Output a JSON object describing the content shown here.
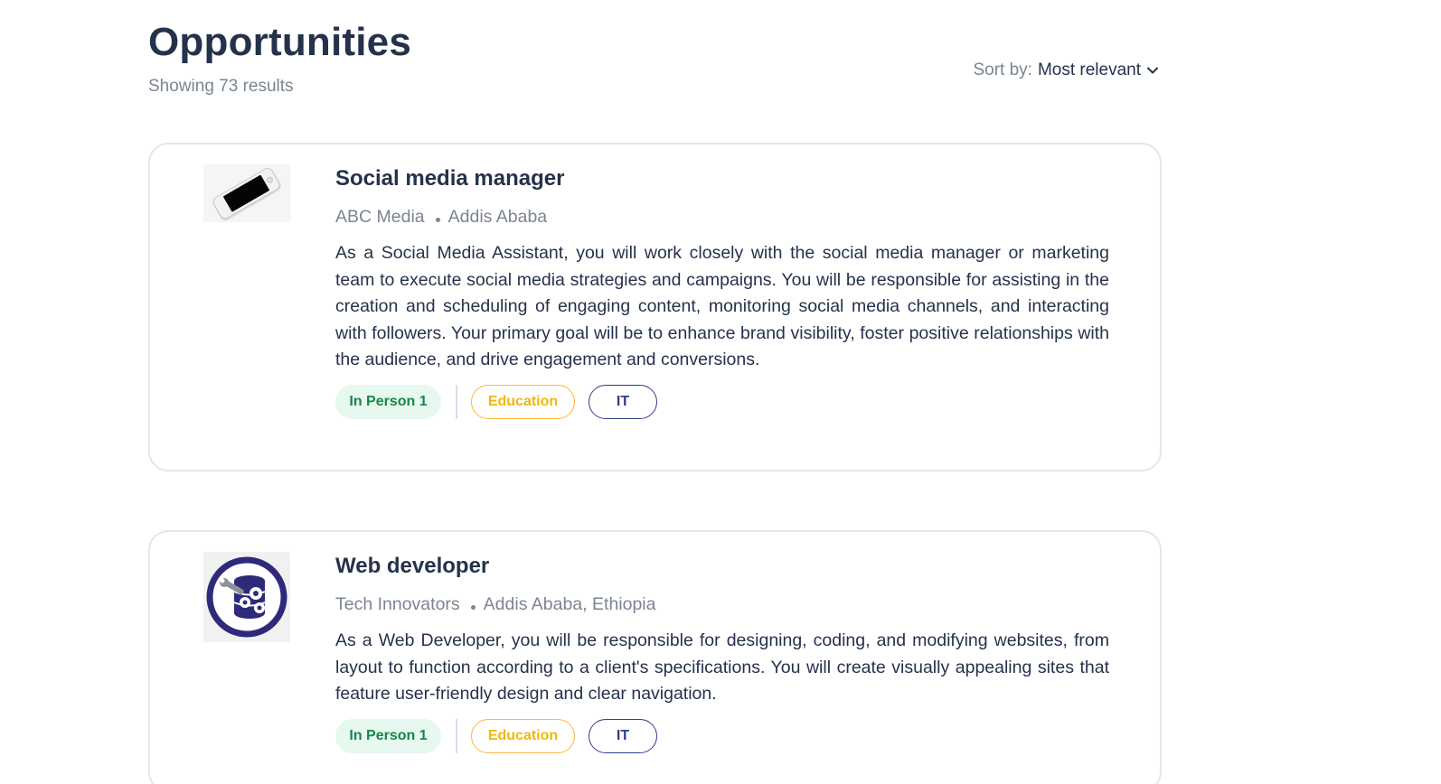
{
  "header": {
    "title": "Opportunities",
    "results": "Showing 73 results",
    "sort_label": "Sort by:",
    "sort_value": "Most relevant",
    "sort_icon": "chevron-down-icon"
  },
  "jobs": [
    {
      "title": "Social media manager",
      "company": "ABC Media",
      "location": "Addis Ababa",
      "description": "As a Social Media Assistant, you will work closely with the social media manager or marketing team to execute social media strategies and campaigns. You will be responsible for assisting in the creation and scheduling of engaging content, monitoring social media channels, and interacting with followers. Your primary goal will be to enhance brand visibility, foster positive relationships with the audience, and drive engagement and conversions.",
      "logo_icon": "smartphone-icon",
      "tags": [
        "In Person 1",
        "Education",
        "IT"
      ]
    },
    {
      "title": "Web developer",
      "company": "Tech Innovators",
      "location": "Addis Ababa, Ethiopia",
      "description": "As a Web Developer, you will be responsible for designing, coding, and modifying websites, from layout to function according to a client's specifications. You will create visually appealing sites that feature user-friendly design and clear navigation.",
      "logo_icon": "database-gears-icon",
      "tags": [
        "In Person 1",
        "Education",
        "IT"
      ]
    }
  ],
  "colors": {
    "heading": "#25324b",
    "muted": "#7c8493",
    "tag_green_bg": "#e7f8ee",
    "tag_green_text": "#17864a",
    "tag_yellow": "#ffb836",
    "tag_blue": "#2f3f86",
    "card_border": "#e4e6ea"
  }
}
